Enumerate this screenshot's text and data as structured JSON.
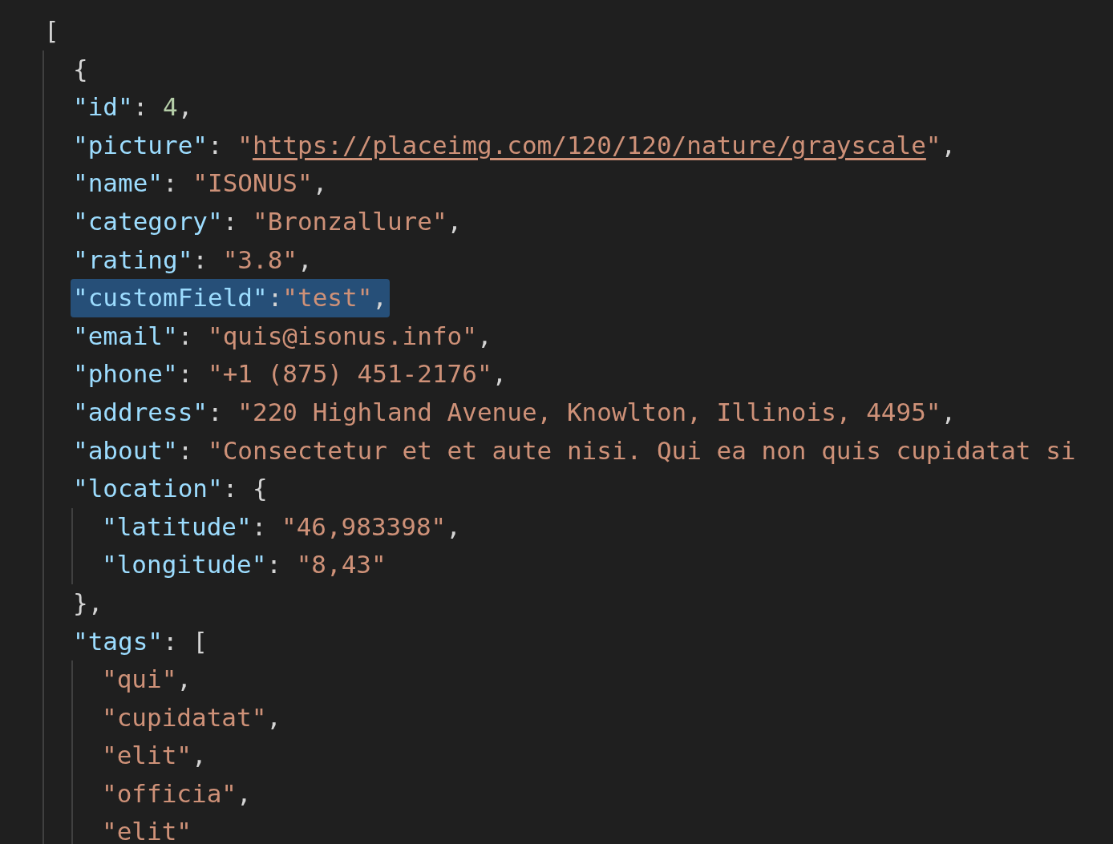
{
  "editor": {
    "lines": [
      {
        "selected": false,
        "tokens": [
          {
            "kind": "punct",
            "text": "["
          }
        ],
        "children": [
          {
            "selected": false,
            "tokens": [
              {
                "kind": "punct",
                "text": "{"
              }
            ]
          },
          {
            "selected": false,
            "tokens": [
              {
                "kind": "key",
                "text": "\"id\""
              },
              {
                "kind": "punct",
                "text": ": "
              },
              {
                "kind": "number",
                "text": "4"
              },
              {
                "kind": "punct",
                "text": ","
              }
            ]
          },
          {
            "selected": false,
            "tokens": [
              {
                "kind": "key",
                "text": "\"picture\""
              },
              {
                "kind": "punct",
                "text": ": "
              },
              {
                "kind": "string",
                "text": "\""
              },
              {
                "kind": "link",
                "text": "https://placeimg.com/120/120/nature/grayscale"
              },
              {
                "kind": "string",
                "text": "\""
              },
              {
                "kind": "punct",
                "text": ","
              }
            ]
          },
          {
            "selected": false,
            "tokens": [
              {
                "kind": "key",
                "text": "\"name\""
              },
              {
                "kind": "punct",
                "text": ": "
              },
              {
                "kind": "string",
                "text": "\"ISONUS\""
              },
              {
                "kind": "punct",
                "text": ","
              }
            ]
          },
          {
            "selected": false,
            "tokens": [
              {
                "kind": "key",
                "text": "\"category\""
              },
              {
                "kind": "punct",
                "text": ": "
              },
              {
                "kind": "string",
                "text": "\"Bronzallure\""
              },
              {
                "kind": "punct",
                "text": ","
              }
            ]
          },
          {
            "selected": false,
            "tokens": [
              {
                "kind": "key",
                "text": "\"rating\""
              },
              {
                "kind": "punct",
                "text": ": "
              },
              {
                "kind": "string",
                "text": "\"3.8\""
              },
              {
                "kind": "punct",
                "text": ","
              }
            ]
          },
          {
            "selected": true,
            "tokens": [
              {
                "kind": "key",
                "text": "\"customField\""
              },
              {
                "kind": "punct",
                "text": ":"
              },
              {
                "kind": "string",
                "text": "\"test\""
              },
              {
                "kind": "punct",
                "text": ","
              }
            ]
          },
          {
            "selected": false,
            "tokens": [
              {
                "kind": "key",
                "text": "\"email\""
              },
              {
                "kind": "punct",
                "text": ": "
              },
              {
                "kind": "string",
                "text": "\"quis@isonus.info\""
              },
              {
                "kind": "punct",
                "text": ","
              }
            ]
          },
          {
            "selected": false,
            "tokens": [
              {
                "kind": "key",
                "text": "\"phone\""
              },
              {
                "kind": "punct",
                "text": ": "
              },
              {
                "kind": "string",
                "text": "\"+1 (875) 451-2176\""
              },
              {
                "kind": "punct",
                "text": ","
              }
            ]
          },
          {
            "selected": false,
            "tokens": [
              {
                "kind": "key",
                "text": "\"address\""
              },
              {
                "kind": "punct",
                "text": ": "
              },
              {
                "kind": "string",
                "text": "\"220 Highland Avenue, Knowlton, Illinois, 4495\""
              },
              {
                "kind": "punct",
                "text": ","
              }
            ]
          },
          {
            "selected": false,
            "tokens": [
              {
                "kind": "key",
                "text": "\"about\""
              },
              {
                "kind": "punct",
                "text": ": "
              },
              {
                "kind": "string",
                "text": "\"Consectetur et et aute nisi. Qui ea non quis cupidatat si"
              }
            ]
          },
          {
            "selected": false,
            "tokens": [
              {
                "kind": "key",
                "text": "\"location\""
              },
              {
                "kind": "punct",
                "text": ": {"
              }
            ],
            "children": [
              {
                "selected": false,
                "tokens": [
                  {
                    "kind": "key",
                    "text": "\"latitude\""
                  },
                  {
                    "kind": "punct",
                    "text": ": "
                  },
                  {
                    "kind": "string",
                    "text": "\"46,983398\""
                  },
                  {
                    "kind": "punct",
                    "text": ","
                  }
                ]
              },
              {
                "selected": false,
                "tokens": [
                  {
                    "kind": "key",
                    "text": "\"longitude\""
                  },
                  {
                    "kind": "punct",
                    "text": ": "
                  },
                  {
                    "kind": "string",
                    "text": "\"8,43\""
                  }
                ]
              }
            ]
          },
          {
            "selected": false,
            "tokens": [
              {
                "kind": "punct",
                "text": "},"
              }
            ]
          },
          {
            "selected": false,
            "tokens": [
              {
                "kind": "key",
                "text": "\"tags\""
              },
              {
                "kind": "punct",
                "text": ": ["
              }
            ],
            "children": [
              {
                "selected": false,
                "tokens": [
                  {
                    "kind": "string",
                    "text": "\"qui\""
                  },
                  {
                    "kind": "punct",
                    "text": ","
                  }
                ]
              },
              {
                "selected": false,
                "tokens": [
                  {
                    "kind": "string",
                    "text": "\"cupidatat\""
                  },
                  {
                    "kind": "punct",
                    "text": ","
                  }
                ]
              },
              {
                "selected": false,
                "tokens": [
                  {
                    "kind": "string",
                    "text": "\"elit\""
                  },
                  {
                    "kind": "punct",
                    "text": ","
                  }
                ]
              },
              {
                "selected": false,
                "tokens": [
                  {
                    "kind": "string",
                    "text": "\"officia\""
                  },
                  {
                    "kind": "punct",
                    "text": ","
                  }
                ]
              },
              {
                "selected": false,
                "tokens": [
                  {
                    "kind": "string",
                    "text": "\"elit\""
                  }
                ]
              }
            ]
          }
        ]
      }
    ]
  }
}
